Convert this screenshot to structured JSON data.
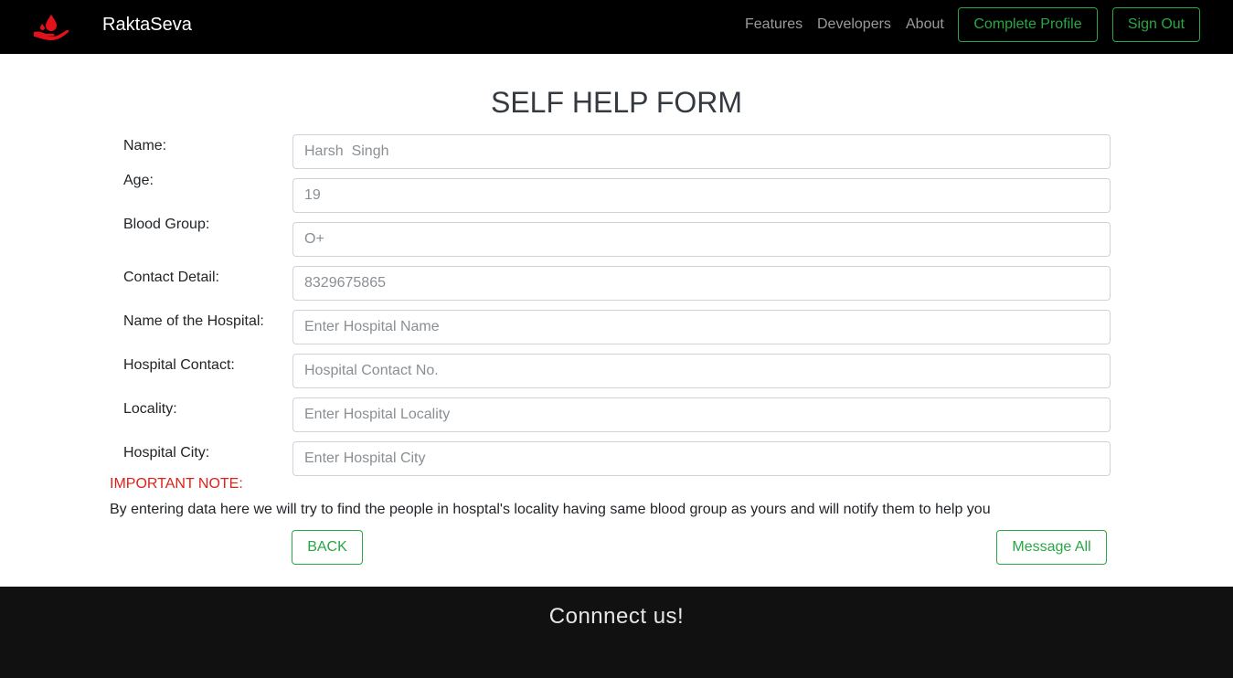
{
  "navbar": {
    "logo_icon": "blood-drop-hand-icon",
    "brand": "RaktaSeva",
    "links": [
      "Features",
      "Developers",
      "About"
    ],
    "complete_profile_label": "Complete Profile",
    "sign_out_label": "Sign Out",
    "accent_color": "#28a745",
    "logo_color": "#e3111b"
  },
  "form": {
    "title": "SELF HELP FORM",
    "fields": [
      {
        "label": "Name:",
        "value": "",
        "placeholder": "Harsh  Singh"
      },
      {
        "label": "Age:",
        "value": "",
        "placeholder": "19"
      },
      {
        "label": "Blood Group:",
        "value": "",
        "placeholder": "O+"
      },
      {
        "label": "Contact Detail:",
        "value": "",
        "placeholder": "8329675865"
      },
      {
        "label": "Name of the Hospital:",
        "value": "",
        "placeholder": "Enter Hospital Name"
      },
      {
        "label": "Hospital Contact:",
        "value": "",
        "placeholder": "Hospital Contact No."
      },
      {
        "label": "Locality:",
        "value": "",
        "placeholder": "Enter Hospital Locality"
      },
      {
        "label": "Hospital City:",
        "value": "",
        "placeholder": "Enter Hospital City"
      }
    ],
    "note_title": "IMPORTANT NOTE:",
    "note_text": "By entering data here we will try to find the people in hosptal's locality having same blood group as yours and will notify them to help you",
    "back_label": "BACK",
    "message_all_label": "Message All",
    "note_color": "#e0201a"
  },
  "footer": {
    "title": "Connnect us!"
  }
}
